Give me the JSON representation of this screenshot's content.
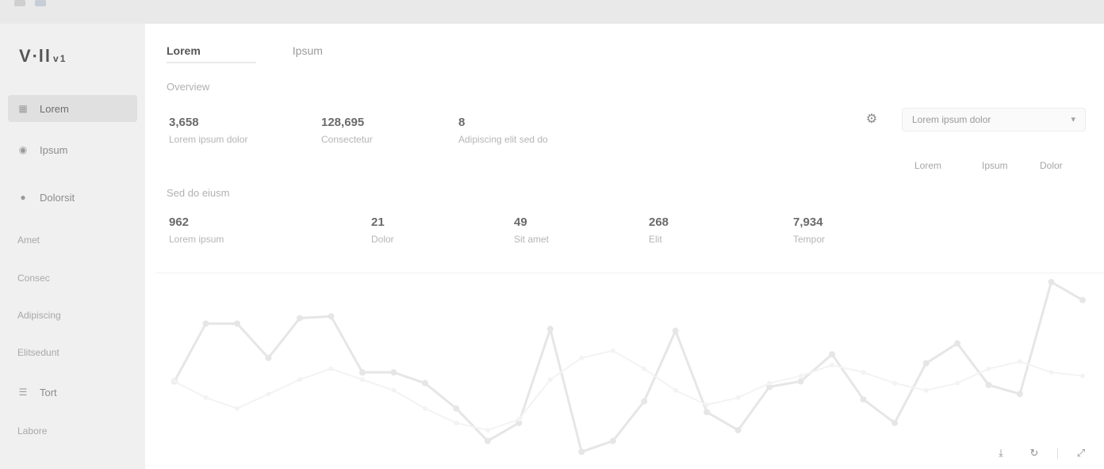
{
  "window": {
    "title_icons": [
      "app-icon",
      "badge-icon"
    ]
  },
  "sidebar": {
    "logo": "V∙ll",
    "logo_suffix": "v1",
    "items": [
      {
        "label": "Lorem",
        "icon": "grid-icon",
        "active": true
      },
      {
        "label": "Ipsum",
        "icon": "circle-icon"
      },
      {
        "label": "Dolorsit",
        "icon": "globe-icon"
      },
      {
        "label": "Amet"
      },
      {
        "label": "Consec"
      },
      {
        "label": "Adipiscing"
      },
      {
        "label": "Elitsedunt"
      },
      {
        "label": "Tort",
        "icon": "list-icon"
      },
      {
        "label": "Labore"
      }
    ]
  },
  "main": {
    "tabs": [
      {
        "label": "Lorem",
        "active": true
      },
      {
        "label": "Ipsum"
      }
    ],
    "overview": {
      "label": "Overview",
      "kpis": [
        {
          "value": "3,658",
          "label": "Lorem ipsum dolor"
        },
        {
          "value": "128,695",
          "label": "Consectetur"
        },
        {
          "value": "8",
          "label": "Adipiscing elit sed do"
        }
      ]
    },
    "filter": {
      "select_value": "Lorem ipsum dolor",
      "ranges": [
        "Lorem",
        "Ipsum",
        "Dolor"
      ]
    },
    "activity": {
      "label": "Sed do eiusm",
      "kpis": [
        {
          "value": "962",
          "label": "Lorem ipsum"
        },
        {
          "value": "21",
          "label": "Dolor"
        },
        {
          "value": "49",
          "label": "Sit amet"
        },
        {
          "value": "268",
          "label": "Elit"
        },
        {
          "value": "7,934",
          "label": "Tempor"
        }
      ]
    }
  },
  "chart_data": {
    "type": "line",
    "title": "",
    "xlabel": "",
    "ylabel": "",
    "x": [
      1,
      2,
      3,
      4,
      5,
      6,
      7,
      8,
      9,
      10,
      11,
      12,
      13,
      14,
      15,
      16,
      17,
      18,
      19,
      20,
      21,
      22,
      23,
      24,
      25,
      26,
      27,
      28,
      29,
      30
    ],
    "series": [
      {
        "values": [
          45,
          77,
          77,
          58,
          80,
          81,
          50,
          50,
          44,
          30,
          12,
          22,
          74,
          6,
          12,
          34,
          73,
          28,
          18,
          42,
          45,
          60,
          35,
          22,
          55,
          66,
          43,
          38,
          100,
          90
        ],
        "color": "#e6e6e6"
      },
      {
        "values": [
          45,
          36,
          30,
          38,
          46,
          52,
          46,
          40,
          30,
          22,
          18,
          24,
          46,
          58,
          62,
          52,
          40,
          32,
          36,
          44,
          48,
          54,
          50,
          44,
          40,
          44,
          52,
          56,
          50,
          48
        ],
        "color": "#f3f3f3"
      }
    ],
    "ylim": [
      0,
      100
    ],
    "grid": false,
    "legend": "none"
  },
  "bottom_controls": [
    "download-icon",
    "refresh-icon",
    "expand-icon"
  ]
}
